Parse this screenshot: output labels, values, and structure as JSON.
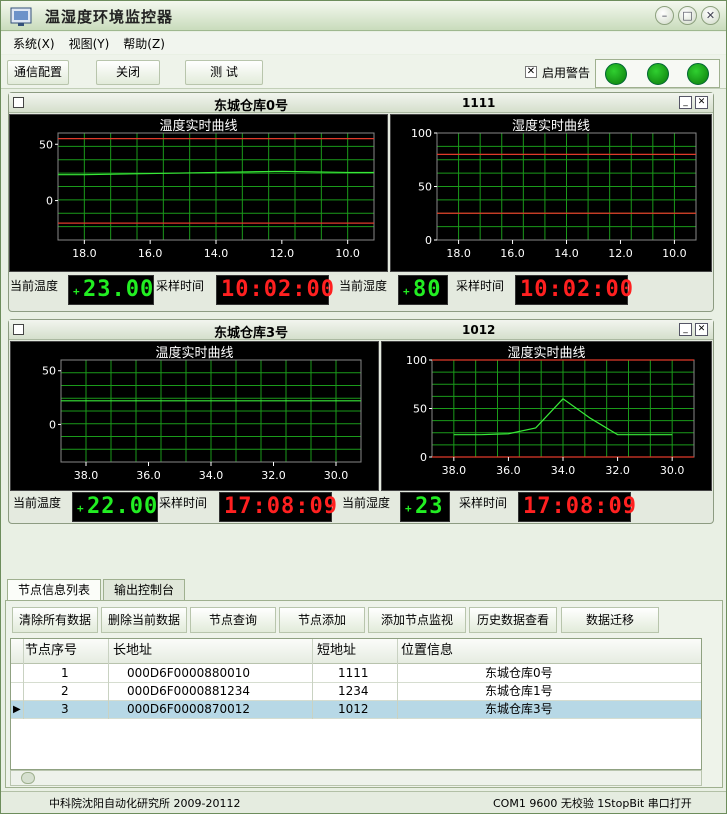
{
  "window": {
    "title": "温湿度环境监控器"
  },
  "menu": [
    "系统(X)",
    "视图(Y)",
    "帮助(Z)"
  ],
  "toolbar": {
    "comm_config": "通信配置",
    "close": "关闭",
    "test": "测 试",
    "alarm_label": "启用警告",
    "alarm_checked": "✕"
  },
  "panels": [
    {
      "name": "东城仓库0号",
      "id": "1111",
      "temp_title": "温度实时曲线",
      "hum_title": "湿度实时曲线",
      "temp_label": "当前温度",
      "temp_value": "23.00",
      "time_label1": "采样时间",
      "time1": "10:02:00",
      "hum_label": "当前湿度",
      "hum_value": "80",
      "time_label2": "采样时间",
      "time2": "10:02:00",
      "temp_yticks": [
        "50",
        "0"
      ],
      "hum_yticks": [
        "100",
        "50",
        "0"
      ],
      "xticks": [
        "18.0",
        "16.0",
        "14.0",
        "12.0",
        "10.0"
      ]
    },
    {
      "name": "东城仓库3号",
      "id": "1012",
      "temp_title": "温度实时曲线",
      "hum_title": "湿度实时曲线",
      "temp_label": "当前温度",
      "temp_value": "22.00",
      "time_label1": "采样时间",
      "time1": "17:08:09",
      "hum_label": "当前湿度",
      "hum_value": "23",
      "time_label2": "采样时间",
      "time2": "17:08:09",
      "temp_yticks": [
        "50",
        "0"
      ],
      "hum_yticks": [
        "100",
        "50",
        "0"
      ],
      "xticks": [
        "38.0",
        "36.0",
        "34.0",
        "32.0",
        "30.0"
      ]
    }
  ],
  "tabs": [
    "节点信息列表",
    "输出控制台"
  ],
  "actions": [
    "清除所有数据",
    "删除当前数据",
    "节点查询",
    "节点添加",
    "添加节点监视",
    "历史数据查看",
    "数据迁移"
  ],
  "table": {
    "headers": [
      "节点序号",
      "长地址",
      "短地址",
      "位置信息"
    ],
    "rows": [
      [
        "1",
        "000D6F0000880010",
        "1111",
        "东城仓库0号"
      ],
      [
        "2",
        "000D6F0000881234",
        "1234",
        "东城仓库1号"
      ],
      [
        "3",
        "000D6F0000870012",
        "1012",
        "东城仓库3号"
      ]
    ],
    "selected_indicator": "▶"
  },
  "status": {
    "left": "中科院沈阳自动化研究所 2009-20112",
    "right": "COM1 9600 无校验 1StopBit 串口打开"
  },
  "chart_data": [
    {
      "type": "line",
      "title": "温度实时曲线",
      "x": [
        18.0,
        16.0,
        14.0,
        12.0,
        10.0
      ],
      "series": [
        {
          "values": [
            23,
            24,
            25,
            26,
            25
          ]
        }
      ],
      "ylim": [
        -35,
        60
      ],
      "thresholds": [
        55,
        -20
      ],
      "grid": true
    },
    {
      "type": "line",
      "title": "湿度实时曲线",
      "x": [
        18.0,
        16.0,
        14.0,
        12.0,
        10.0
      ],
      "series": [],
      "ylim": [
        0,
        100
      ],
      "thresholds": [
        80,
        25
      ],
      "grid": true
    },
    {
      "type": "line",
      "title": "温度实时曲线",
      "x": [
        38.0,
        36.0,
        34.0,
        32.0,
        30.0
      ],
      "series": [
        {
          "values": [
            22,
            22,
            22,
            22,
            22
          ]
        }
      ],
      "ylim": [
        -35,
        60
      ],
      "grid": true
    },
    {
      "type": "line",
      "title": "湿度实时曲线",
      "x": [
        38.0,
        37.0,
        36.0,
        35.0,
        34.0,
        33.0,
        32.0,
        30.0
      ],
      "series": [
        {
          "values": [
            23,
            23,
            24,
            30,
            60,
            40,
            23,
            23
          ]
        }
      ],
      "ylim": [
        0,
        100
      ],
      "thresholds": [
        100,
        0
      ],
      "grid": true
    }
  ]
}
